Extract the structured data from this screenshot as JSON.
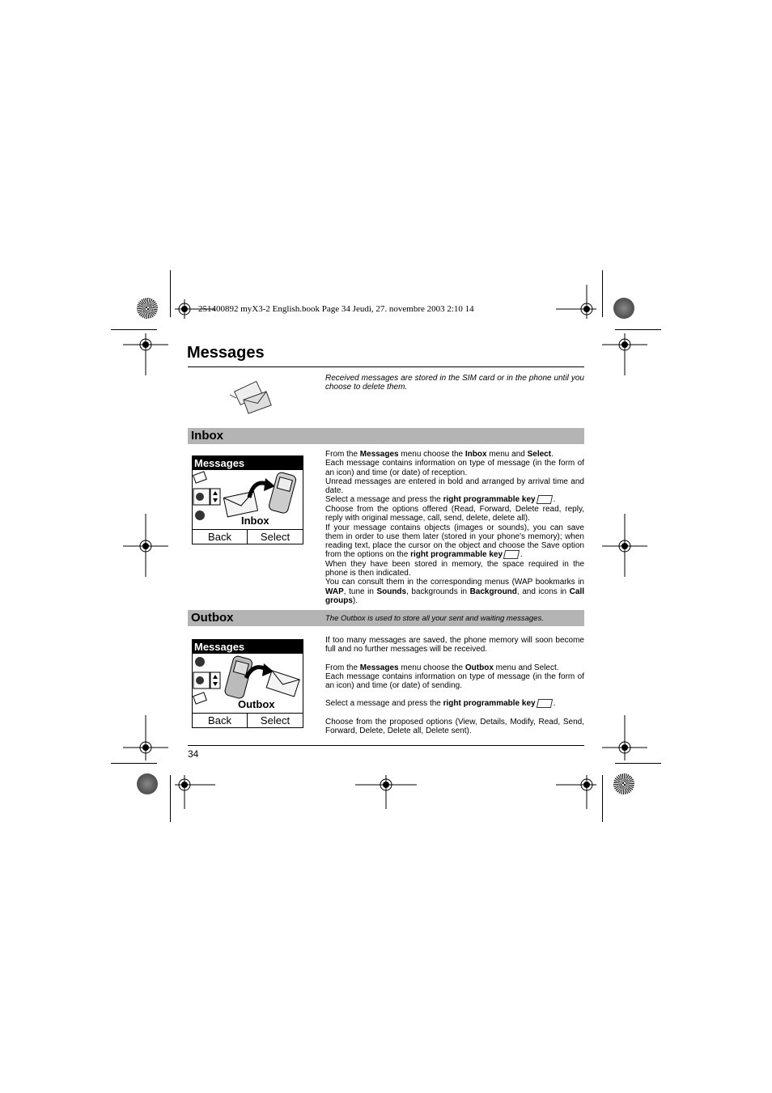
{
  "header": {
    "print_line": "251400892 myX3-2 English.book  Page 34  Jeudi, 27. novembre 2003  2:10 14"
  },
  "page": {
    "title": "Messages",
    "intro": "Received messages are stored in the SIM card or in the phone until you choose to delete them.",
    "page_number": "34"
  },
  "inbox": {
    "heading": "Inbox",
    "screen": {
      "title": "Messages",
      "label": "Inbox",
      "soft_left": "Back",
      "soft_right": "Select"
    },
    "paragraphs": [
      {
        "parts": [
          "From the ",
          {
            "b": "Messages"
          },
          " menu choose the ",
          {
            "b": "Inbox"
          },
          " menu and ",
          {
            "b": "Select"
          },
          "."
        ]
      },
      {
        "parts": [
          "Each message contains information on type of message (in the form of an icon) and time (or date) of reception."
        ]
      },
      {
        "parts": [
          "Unread messages are entered in bold and arranged by arrival time and date."
        ]
      },
      {
        "parts": [
          "Select a message and press the ",
          {
            "b": "right programmable key"
          },
          {
            "icon": "right-softkey-icon"
          },
          "."
        ]
      },
      {
        "parts": [
          "Choose from the options offered (Read, Forward, Delete read, reply, reply with original message, call, send, delete, delete all)."
        ]
      },
      {
        "parts": [
          "If your message contains objects (images or sounds), you can save them in order to use them later (stored in your phone's memory); when reading text, place the cursor on the object and choose the Save option from the options on the ",
          {
            "b": "right programmable key"
          },
          {
            "icon": "right-softkey-icon"
          },
          "."
        ]
      },
      {
        "parts": [
          "When they have been stored in memory, the space required in the phone is then indicated."
        ]
      },
      {
        "parts": [
          "You can consult them in the corresponding menus (WAP bookmarks in ",
          {
            "b": "WAP"
          },
          ", tune in ",
          {
            "b": "Sounds"
          },
          ", backgrounds in ",
          {
            "b": "Background"
          },
          ", and icons in ",
          {
            "b": "Call groups"
          },
          ")."
        ]
      }
    ]
  },
  "outbox": {
    "heading": "Outbox",
    "subheading": "The Outbox is used to store all your sent and waiting messages.",
    "screen": {
      "title": "Messages",
      "label": "Outbox",
      "soft_left": "Back",
      "soft_right": "Select"
    },
    "paragraphs": [
      {
        "parts": [
          "If too many messages are saved, the phone memory will soon become full and no further messages will be received."
        ],
        "gap_after": true
      },
      {
        "parts": [
          "From the ",
          {
            "b": "Messages"
          },
          " menu choose the ",
          {
            "b": "Outbox"
          },
          " menu and Select."
        ]
      },
      {
        "parts": [
          "Each message contains information on type of message (in the form of an icon) and time (or date) of sending."
        ],
        "gap_after": true
      },
      {
        "parts": [
          "Select a message and press the ",
          {
            "b": "right programmable key"
          },
          {
            "icon": "right-softkey-icon"
          },
          "."
        ],
        "gap_after": true
      },
      {
        "parts": [
          "Choose from the proposed options (View, Details, Modify, Read, Send, Forward, Delete, Delete all, Delete sent)."
        ]
      }
    ]
  }
}
